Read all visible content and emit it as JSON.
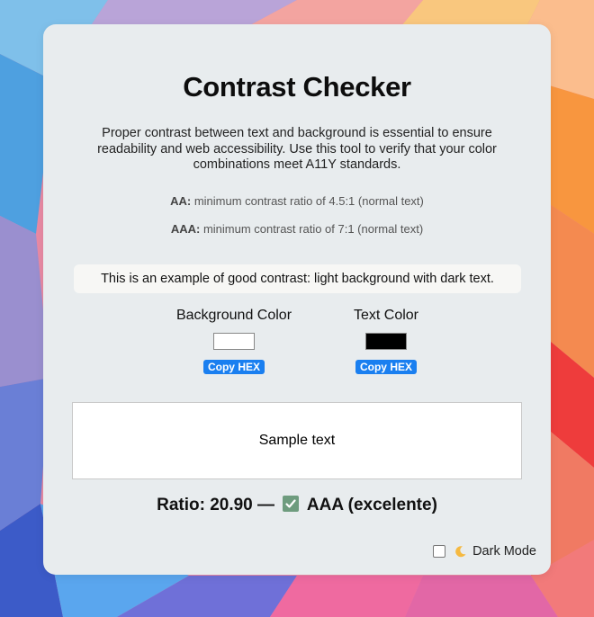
{
  "app": {
    "title": "Contrast Checker",
    "intro": "Proper contrast between text and background is essential to ensure readability and web accessibility. Use this tool to verify that your color combinations meet A11Y standards."
  },
  "levels": {
    "aa_label": "AA:",
    "aa_text": " minimum contrast ratio of 4.5:1 (normal text)",
    "aaa_label": "AAA:",
    "aaa_text": " minimum contrast ratio of 7:1 (normal text)"
  },
  "example": {
    "text": "This is an example of good contrast: light background with dark text."
  },
  "pickers": {
    "background": {
      "label": "Background Color",
      "value": "#ffffff",
      "copy_label": "Copy HEX"
    },
    "text": {
      "label": "Text Color",
      "value": "#000000",
      "copy_label": "Copy HEX"
    }
  },
  "sample": {
    "text": "Sample text"
  },
  "result": {
    "ratio_prefix": "Ratio: 20.90 —",
    "ratio": 20.9,
    "grade": "AAA (excelente)",
    "passed": true
  },
  "dark_mode": {
    "label": "Dark Mode",
    "checked": false,
    "icon": "moon-icon"
  },
  "colors": {
    "card_bg": "#e8ecee",
    "accent": "#1a7ff0",
    "check": "#6e9c7e"
  }
}
